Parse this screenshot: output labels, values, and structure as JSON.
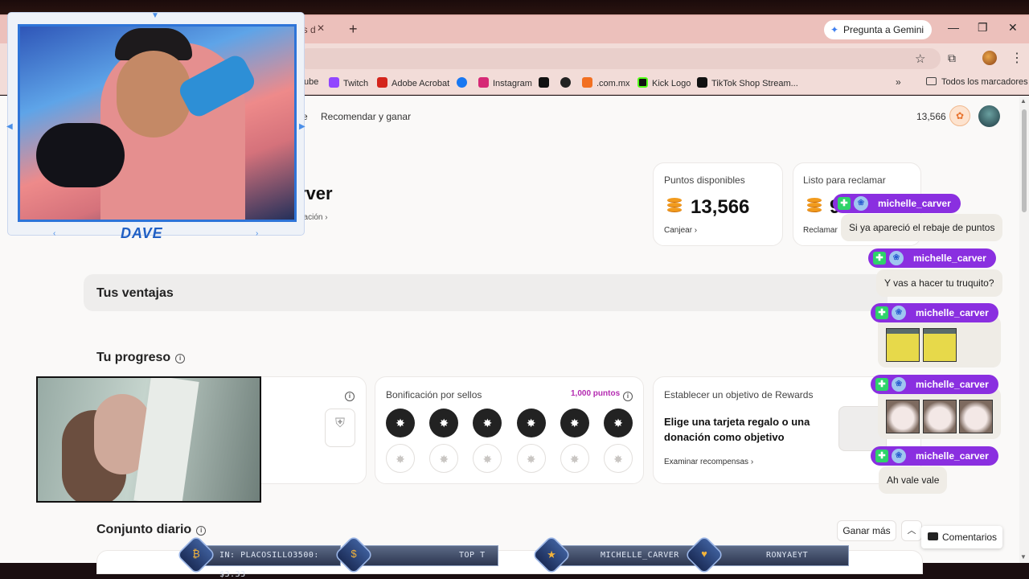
{
  "browser": {
    "tab_title": "es d",
    "new_tab": "+",
    "gemini": "Pregunta a Gemini",
    "bookmarks": [
      {
        "label": "ube",
        "color": "#ff0000"
      },
      {
        "label": "Twitch",
        "color": "#9146ff"
      },
      {
        "label": "Adobe Acrobat",
        "color": "#d4251c"
      },
      {
        "label": "",
        "color": "#1877f2"
      },
      {
        "label": "Instagram",
        "color": "#d62976"
      },
      {
        "label": "",
        "color": "#111111"
      },
      {
        "label": "",
        "color": "#222222"
      },
      {
        "label": ".com.mx",
        "color": "#f26f21"
      },
      {
        "label": "Kick Logo",
        "color": "#53fc18"
      },
      {
        "label": "TikTok Shop Stream...",
        "color": "#111111"
      }
    ],
    "all_bookmarks": "Todos los marcadores"
  },
  "page": {
    "nav_fragment": "e",
    "nav_link": "Recomendar y ganar",
    "top_points": "13,566",
    "name_fragment": "rver",
    "name_sub": "nación",
    "points_card": {
      "label": "Puntos disponibles",
      "value": "13,566",
      "link": "Canjear"
    },
    "claim_card": {
      "label": "Listo para reclamar",
      "value": "9",
      "link": "Reclamar"
    },
    "ventajas": "Tus ventajas",
    "progreso": "Tu progreso",
    "stamps": {
      "label": "Bonificación por sellos",
      "points": "1,000 puntos",
      "filled": 6,
      "empty": 6
    },
    "goal": {
      "label": "Establecer un objetivo de Rewards",
      "text": "Elige una tarjeta regalo o una donación como objetivo",
      "link": "Examinar recompensas"
    },
    "conjunto": "Conjunto diario",
    "ganar_mas": "Ganar más",
    "comentarios": "Comentarios"
  },
  "overlay": {
    "cam_name": "DAVE",
    "chat": [
      {
        "user": "michelle_carver",
        "message": "Si ya apareció el rebaje de puntos"
      },
      {
        "user": "michelle_carver",
        "message": "Y vas a hacer tu truquito?"
      },
      {
        "user": "michelle_carver",
        "emotes": 2
      },
      {
        "user": "michelle_carver",
        "emotes": 3
      },
      {
        "user": "michelle_carver",
        "message": "Ah vale vale"
      }
    ],
    "ticker": {
      "donation": "IN: PLACOSILLO3500: $3.33",
      "top": "TOP T",
      "user1": "MICHELLE_CARVER",
      "user2": "RONYAEYT"
    }
  }
}
